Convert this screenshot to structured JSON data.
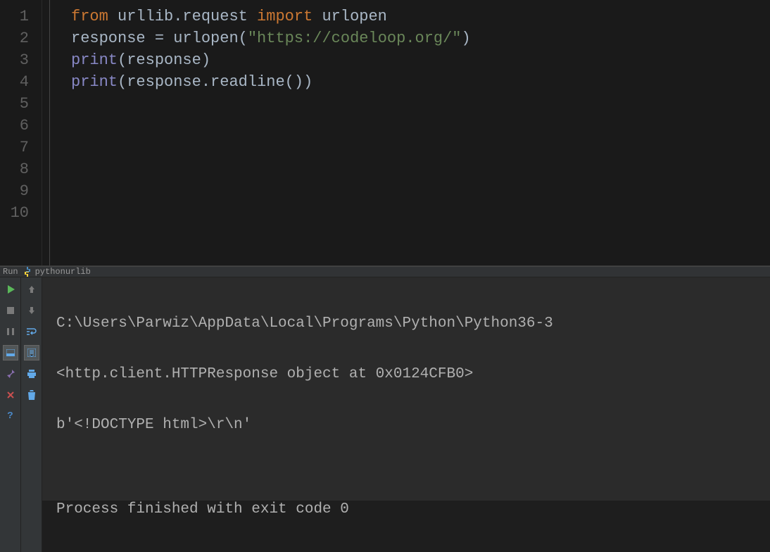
{
  "editor": {
    "lines": {
      "1": {
        "num": "1"
      },
      "2": {
        "num": "2"
      },
      "3": {
        "num": "3"
      },
      "4": {
        "num": "4"
      },
      "5": {
        "num": "5"
      },
      "6": {
        "num": "6"
      },
      "7": {
        "num": "7"
      },
      "8": {
        "num": "8"
      },
      "9": {
        "num": "9"
      },
      "10": {
        "num": "10"
      }
    },
    "code": {
      "from": "from",
      "module": " urllib.request ",
      "import": "import",
      "urlopen": " urlopen",
      "response": "response ",
      "eq": "= ",
      "urlopen_call": "urlopen",
      "lparen": "(",
      "url_string": "\"https://codeloop.org/\"",
      "rparen": ")",
      "print1": "print",
      "print1_arg": "(response)",
      "print2": "print",
      "print2_lparen": "(",
      "print2_obj": "response",
      "print2_dot": ".",
      "print2_method": "readline",
      "print2_call": "()",
      "print2_rparen": ")"
    }
  },
  "run_panel": {
    "label": "Run",
    "tab_name": "pythonurlib",
    "output": {
      "line1": "C:\\Users\\Parwiz\\AppData\\Local\\Programs\\Python\\Python36-3",
      "line2": "<http.client.HTTPResponse object at 0x0124CFB0>",
      "line3": "b'<!DOCTYPE html>\\r\\n'",
      "line4": "",
      "line5": "Process finished with exit code 0"
    }
  }
}
